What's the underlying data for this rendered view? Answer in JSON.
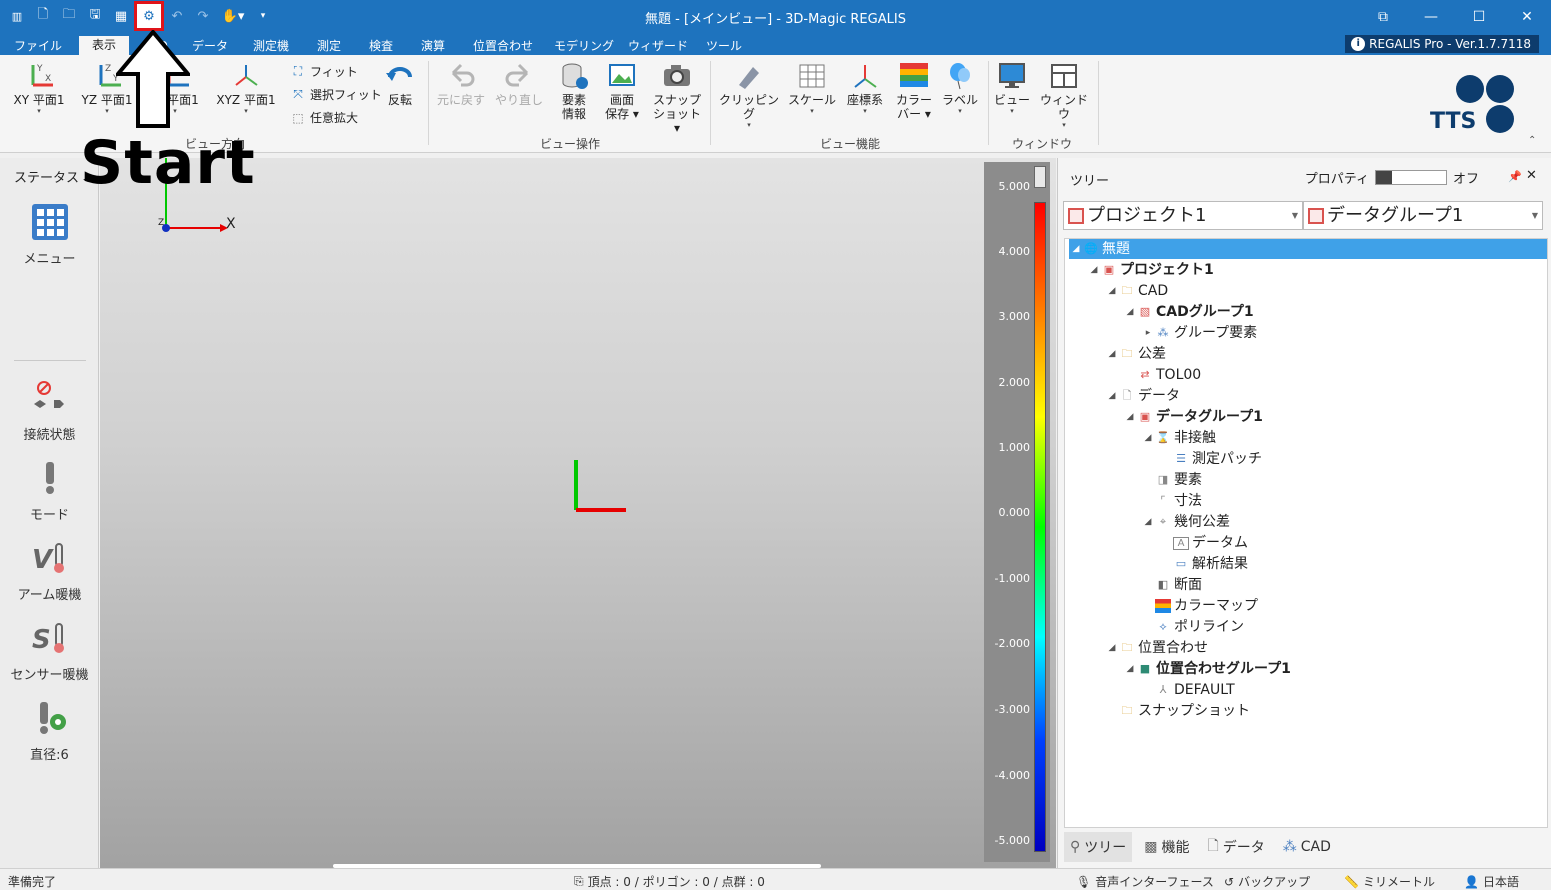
{
  "window": {
    "title": "無題 - [メインビュー] - 3D-Magic REGALIS",
    "controls": [
      "⧉",
      "—",
      "☐",
      "✕"
    ]
  },
  "quick_access": {
    "icons": [
      "app-logo-icon",
      "new-file-icon",
      "open-folder-icon",
      "save-icon",
      "grid-icon",
      "settings-gear-icon",
      "undo-icon",
      "redo-icon",
      "hand-icon"
    ]
  },
  "ribbon_tabs": [
    {
      "label": "ファイル"
    },
    {
      "label": "表示",
      "active": true
    },
    {
      "label": "CAD"
    },
    {
      "label": "データ"
    },
    {
      "label": "測定機"
    },
    {
      "label": "測定"
    },
    {
      "label": "検査"
    },
    {
      "label": "演算"
    },
    {
      "label": "位置合わせ"
    },
    {
      "label": "モデリング"
    },
    {
      "label": "ウィザード"
    },
    {
      "label": "ツール"
    }
  ],
  "version_badge": "REGALIS Pro - Ver.1.7.7118",
  "ribbon": {
    "view_direction": {
      "xy": "XY 平面1",
      "yz": "YZ 平面1",
      "zx": "平面1",
      "xyz": "XYZ 平面1",
      "fit": "フィット",
      "select_fit": "選択フィット",
      "any_zoom": "任意拡大",
      "flip": "反転",
      "group_label": "ビュー方向"
    },
    "view_ops": {
      "undo": "元に戻す",
      "redo": "やり直し",
      "element_info_1": "要素",
      "element_info_2": "情報",
      "screen_save_1": "画面",
      "screen_save_2": "保存",
      "snapshot_1": "スナップ",
      "snapshot_2": "ショット",
      "group_label": "ビュー操作"
    },
    "view_funcs": {
      "clipping": "クリッピング",
      "scale": "スケール",
      "coord": "座標系",
      "colorbar_1": "カラー",
      "colorbar_2": "バー",
      "label": "ラベル",
      "group_label": "ビュー機能"
    },
    "window_grp": {
      "view": "ビュー",
      "window": "ウィンドウ",
      "group_label": "ウィンドウ"
    },
    "logo": "TTS"
  },
  "status_panel": {
    "title": "ステータス",
    "menu": "メニュー",
    "connection": "接続状態",
    "mode": "モード",
    "arm_warm": "アーム暖機",
    "sensor_warm": "センサー暖機",
    "diameter": "直径:6"
  },
  "viewport": {
    "axis_x": "X",
    "axis_y": "Y",
    "axis_z": "Z",
    "legend": [
      "5.000",
      "4.000",
      "3.000",
      "2.000",
      "1.000",
      "0.000",
      "-1.000",
      "-2.000",
      "-3.000",
      "-4.000",
      "-5.000"
    ]
  },
  "right_panel": {
    "title": "ツリー",
    "property_label": "プロパティ",
    "property_state": "オフ",
    "project_combo": "プロジェクト1",
    "datagroup_combo": "データグループ1",
    "tree": [
      {
        "label": "無題",
        "selected": true
      },
      {
        "label": "プロジェクト1",
        "bold": true
      },
      {
        "label": "CAD"
      },
      {
        "label": "CADグループ1",
        "bold": true
      },
      {
        "label": "グループ要素"
      },
      {
        "label": "公差"
      },
      {
        "label": "TOL00"
      },
      {
        "label": "データ"
      },
      {
        "label": "データグループ1",
        "bold": true
      },
      {
        "label": "非接触"
      },
      {
        "label": "測定パッチ"
      },
      {
        "label": "要素"
      },
      {
        "label": "寸法"
      },
      {
        "label": "幾何公差"
      },
      {
        "label": "データム"
      },
      {
        "label": "解析結果"
      },
      {
        "label": "断面"
      },
      {
        "label": "カラーマップ"
      },
      {
        "label": "ポリライン"
      },
      {
        "label": "位置合わせ"
      },
      {
        "label": "位置合わせグループ1",
        "bold": true
      },
      {
        "label": "DEFAULT"
      },
      {
        "label": "スナップショット"
      }
    ],
    "bottom_tabs": [
      {
        "label": "ツリー",
        "active": true
      },
      {
        "label": "機能"
      },
      {
        "label": "データ"
      },
      {
        "label": "CAD"
      }
    ]
  },
  "statusbar": {
    "left": "準備完了",
    "center": "頂点 : 0 / ポリゴン : 0 / 点群 : 0",
    "voice": "音声インターフェース",
    "backup": "バックアップ",
    "unit": "ミリメートル",
    "lang": "日本語"
  },
  "overlay": {
    "start_label": "Start"
  }
}
